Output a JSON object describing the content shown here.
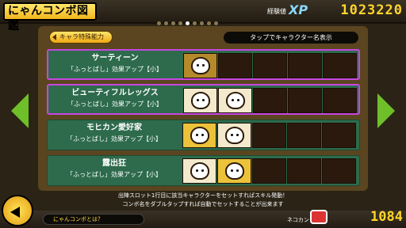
{
  "header": {
    "title": "にゃんコンボ図鑑",
    "xp_label": "経験値",
    "xp_mark": "XP",
    "xp_value": "1023220"
  },
  "filter": {
    "label": "キャラ特殊能力"
  },
  "hint": "タップでキャラクター名表示",
  "rows": [
    {
      "name": "サーティーン",
      "effect": "「ふっとばし」効果アップ【小】",
      "selected": true
    },
    {
      "name": "ビューティフルレッグス",
      "effect": "「ふっとばし」効果アップ【小】",
      "selected": true
    },
    {
      "name": "モヒカン愛好家",
      "effect": "「ふっとばし」効果アップ【小】",
      "selected": false
    },
    {
      "name": "露出狂",
      "effect": "「ふっとばし」効果アップ【小】",
      "selected": false
    }
  ],
  "info": [
    "出陣スロット1行目に該当キャラクターをセットすればスキル発動！",
    "コンボ名をダブルタップすれば自動でセットすることが出来ます"
  ],
  "footer": {
    "help_label": "にゃんコンボとは？",
    "nekokan_label": "ネコカン",
    "nekokan_value": "1084"
  },
  "pagination": {
    "pages": 9,
    "current": 5
  },
  "colors": {
    "accent": "#f2b51d",
    "selected_border": "#c846e0",
    "row_bg": "#2d6b4c",
    "nav_arrow": "#6fbf2a"
  }
}
